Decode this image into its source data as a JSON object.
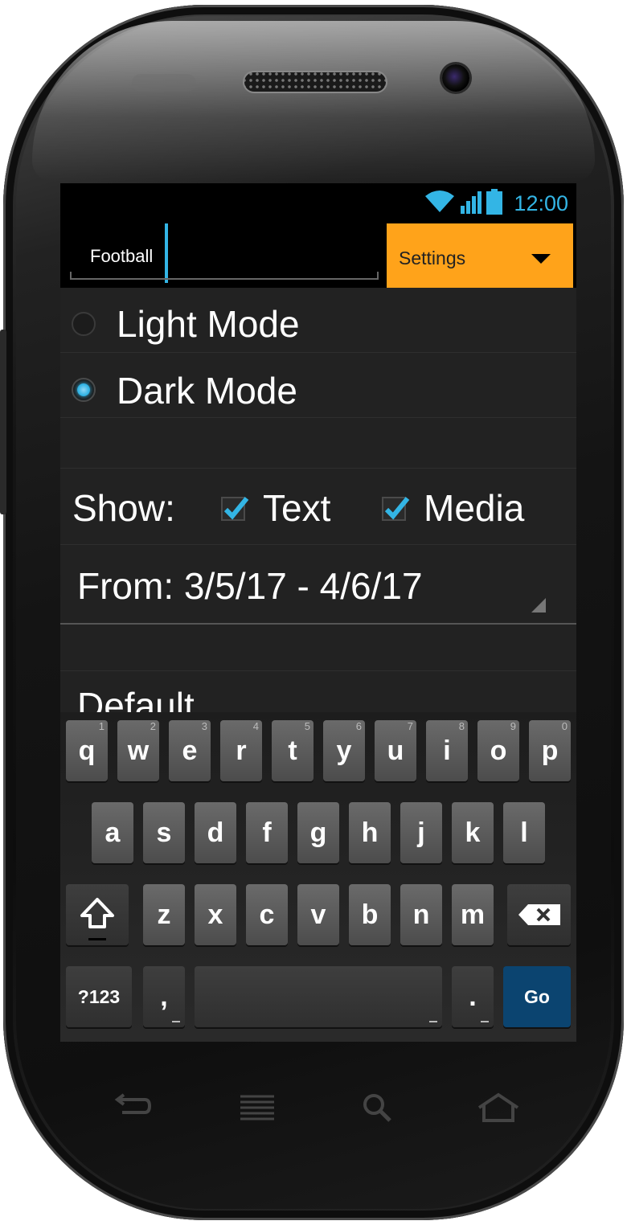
{
  "status_bar": {
    "time": "12:00",
    "icons": [
      "wifi-icon",
      "signal-icon",
      "battery-icon"
    ]
  },
  "action_bar": {
    "search_value": "Football",
    "settings_label": "Settings"
  },
  "theme": {
    "options": [
      {
        "label": "Light Mode",
        "selected": false
      },
      {
        "label": "Dark Mode",
        "selected": true
      }
    ]
  },
  "show": {
    "label": "Show:",
    "options": [
      {
        "label": "Text",
        "checked": true
      },
      {
        "label": "Media",
        "checked": true
      }
    ]
  },
  "date_range": {
    "value": "From: 3/5/17 - 4/6/17"
  },
  "default_row": {
    "label": "Default"
  },
  "keyboard": {
    "row1": [
      {
        "key": "q",
        "hint": "1"
      },
      {
        "key": "w",
        "hint": "2"
      },
      {
        "key": "e",
        "hint": "3"
      },
      {
        "key": "r",
        "hint": "4"
      },
      {
        "key": "t",
        "hint": "5"
      },
      {
        "key": "y",
        "hint": "6"
      },
      {
        "key": "u",
        "hint": "7"
      },
      {
        "key": "i",
        "hint": "8"
      },
      {
        "key": "o",
        "hint": "9"
      },
      {
        "key": "p",
        "hint": "0"
      }
    ],
    "row2": [
      "a",
      "s",
      "d",
      "f",
      "g",
      "h",
      "j",
      "k",
      "l"
    ],
    "row3": [
      "z",
      "x",
      "c",
      "v",
      "b",
      "n",
      "m"
    ],
    "symbols_label": "?123",
    "comma": ",",
    "period": ".",
    "go_label": "Go"
  },
  "colors": {
    "accent": "#33b5e5",
    "settings_bg": "#ffa31a",
    "go_key": "#0b4470"
  }
}
